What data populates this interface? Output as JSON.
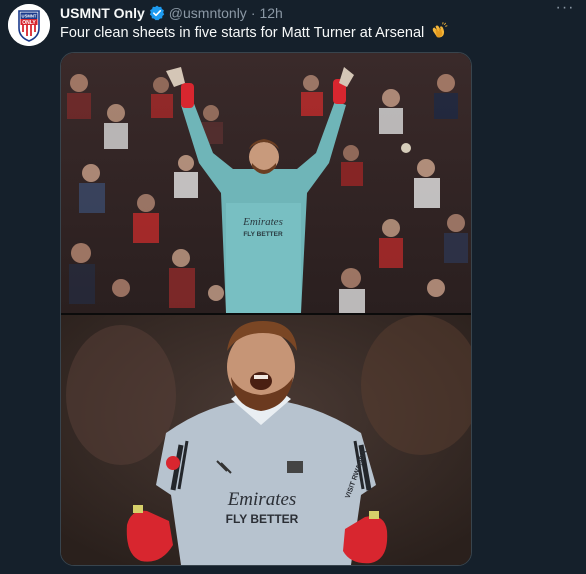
{
  "tweet": {
    "author_name": "USMNT Only",
    "author_handle": "@usmntonly",
    "separator": "·",
    "time": "12h",
    "text": "Four clean sheets in five starts for Matt Turner at Arsenal",
    "emoji": "clapping-hands-icon",
    "avatar": {
      "line1": "USMNT",
      "line2": "ONLY"
    },
    "more_label": "···"
  },
  "media": {
    "top_photo": {
      "shirt_sponsor": "Emirates",
      "shirt_slogan": "FLY BETTER"
    },
    "bottom_photo": {
      "shirt_sponsor": "Emirates",
      "shirt_slogan": "FLY BETTER",
      "sleeve_text": "VISIT RWANDA"
    }
  },
  "colors": {
    "background": "#15202b",
    "text_primary": "#f7f9f9",
    "text_secondary": "#8b98a5",
    "verified": "#1d9bf0",
    "jersey_top": "#6fb5b8",
    "jersey_bottom": "#b7c3cf",
    "glove": "#d8262f"
  }
}
